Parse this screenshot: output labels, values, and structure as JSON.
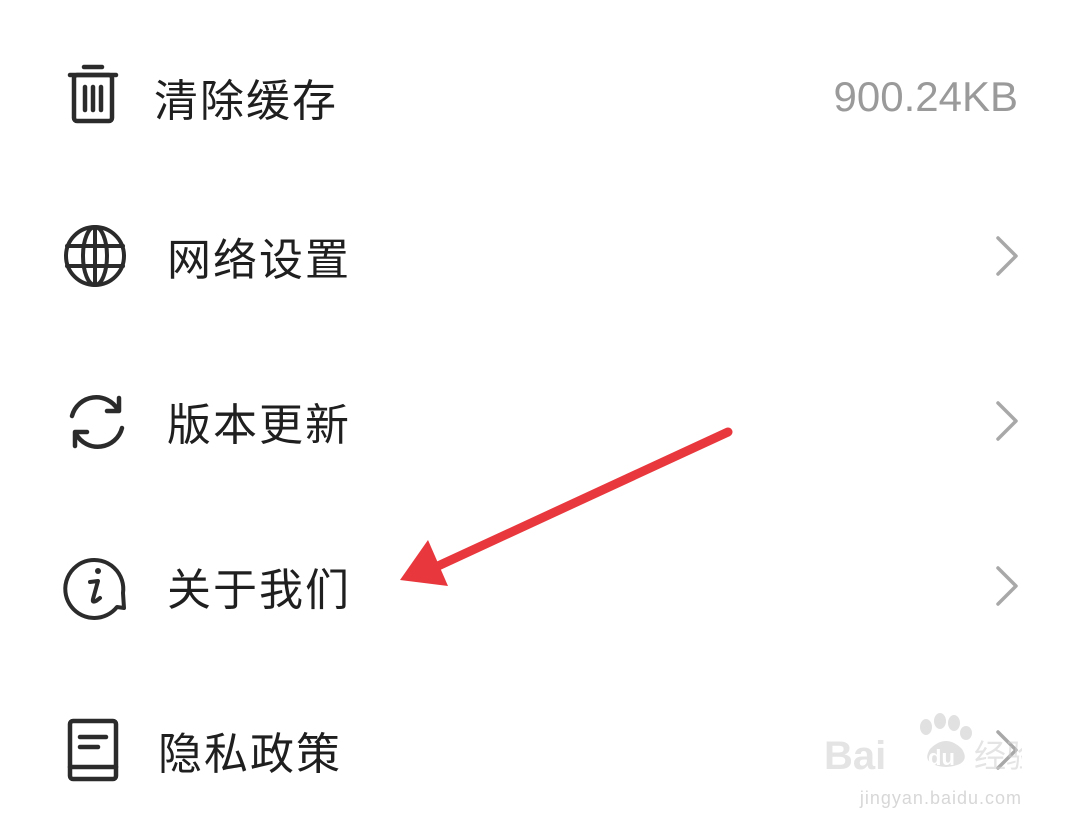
{
  "settings": {
    "clear_cache": {
      "label": "清除缓存",
      "value": "900.24KB",
      "icon": "trash-icon"
    },
    "network": {
      "label": "网络设置",
      "icon": "globe-icon"
    },
    "update": {
      "label": "版本更新",
      "icon": "refresh-icon"
    },
    "about": {
      "label": "关于我们",
      "icon": "info-bubble-icon"
    },
    "privacy": {
      "label": "隐私政策",
      "icon": "document-icon"
    }
  },
  "annotation": {
    "color": "#e8383d"
  },
  "watermark": {
    "brand_latin": "Bai",
    "brand_du": "du",
    "brand_cn": "经验",
    "url": "jingyan.baidu.com"
  }
}
